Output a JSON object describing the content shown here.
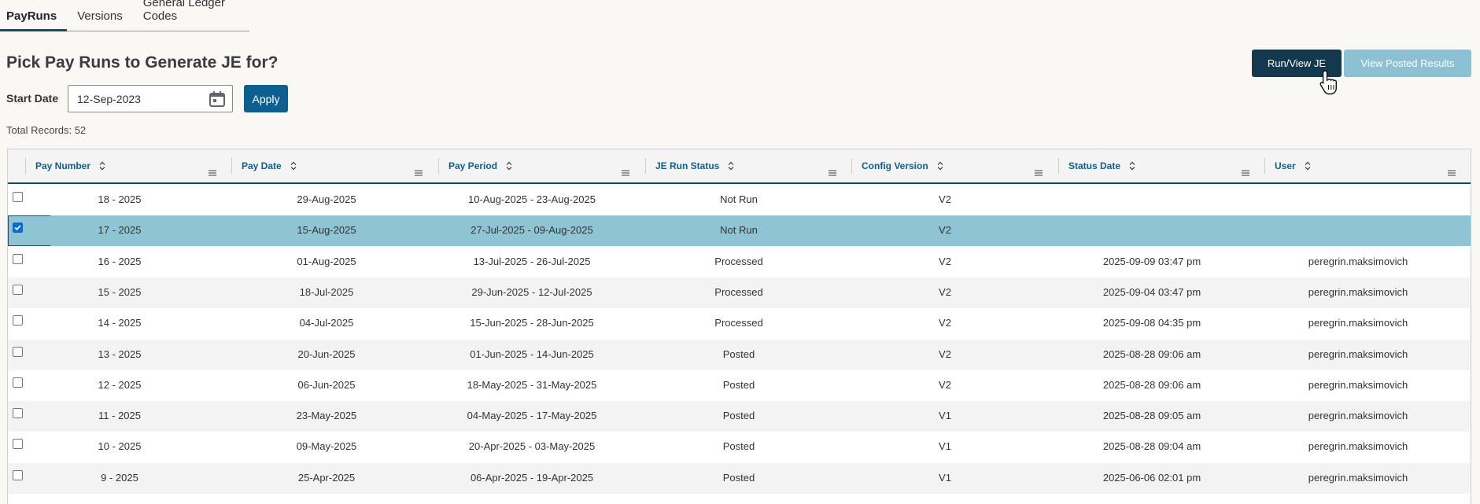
{
  "tabs": [
    "PayRuns",
    "Versions",
    "General Ledger Codes"
  ],
  "title": "Pick Pay Runs to Generate JE for?",
  "filter": {
    "start_label": "Start Date",
    "start_value": "12-Sep-2023",
    "apply_label": "Apply"
  },
  "total_records": "Total Records: 52",
  "actions": {
    "run_view": "Run/View JE",
    "view_posted": "View Posted Results"
  },
  "columns": [
    "Pay Number",
    "Pay Date",
    "Pay Period",
    "JE Run Status",
    "Config Version",
    "Status Date",
    "User"
  ],
  "rows": [
    {
      "pay_number": "18 - 2025",
      "pay_date": "29-Aug-2025",
      "pay_period": "10-Aug-2025 - 23-Aug-2025",
      "status": "Not Run",
      "config": "V2",
      "status_date": "",
      "user": "",
      "checked": false
    },
    {
      "pay_number": "17 - 2025",
      "pay_date": "15-Aug-2025",
      "pay_period": "27-Jul-2025 - 09-Aug-2025",
      "status": "Not Run",
      "config": "V2",
      "status_date": "",
      "user": "",
      "checked": true
    },
    {
      "pay_number": "16 - 2025",
      "pay_date": "01-Aug-2025",
      "pay_period": "13-Jul-2025 - 26-Jul-2025",
      "status": "Processed",
      "config": "V2",
      "status_date": "2025-09-09 03:47 pm",
      "user": "peregrin.maksimovich",
      "checked": false
    },
    {
      "pay_number": "15 - 2025",
      "pay_date": "18-Jul-2025",
      "pay_period": "29-Jun-2025 - 12-Jul-2025",
      "status": "Processed",
      "config": "V2",
      "status_date": "2025-09-04 03:47 pm",
      "user": "peregrin.maksimovich",
      "checked": false
    },
    {
      "pay_number": "14 - 2025",
      "pay_date": "04-Jul-2025",
      "pay_period": "15-Jun-2025 - 28-Jun-2025",
      "status": "Processed",
      "config": "V2",
      "status_date": "2025-09-08 04:35 pm",
      "user": "peregrin.maksimovich",
      "checked": false
    },
    {
      "pay_number": "13 - 2025",
      "pay_date": "20-Jun-2025",
      "pay_period": "01-Jun-2025 - 14-Jun-2025",
      "status": "Posted",
      "config": "V2",
      "status_date": "2025-08-28 09:06 am",
      "user": "peregrin.maksimovich",
      "checked": false
    },
    {
      "pay_number": "12 - 2025",
      "pay_date": "06-Jun-2025",
      "pay_period": "18-May-2025 - 31-May-2025",
      "status": "Posted",
      "config": "V2",
      "status_date": "2025-08-28 09:06 am",
      "user": "peregrin.maksimovich",
      "checked": false
    },
    {
      "pay_number": "11 - 2025",
      "pay_date": "23-May-2025",
      "pay_period": "04-May-2025 - 17-May-2025",
      "status": "Posted",
      "config": "V1",
      "status_date": "2025-08-28 09:05 am",
      "user": "peregrin.maksimovich",
      "checked": false
    },
    {
      "pay_number": "10 - 2025",
      "pay_date": "09-May-2025",
      "pay_period": "20-Apr-2025 - 03-May-2025",
      "status": "Posted",
      "config": "V1",
      "status_date": "2025-08-28 09:04 am",
      "user": "peregrin.maksimovich",
      "checked": false
    },
    {
      "pay_number": "9 - 2025",
      "pay_date": "25-Apr-2025",
      "pay_period": "06-Apr-2025 - 19-Apr-2025",
      "status": "Posted",
      "config": "V1",
      "status_date": "2025-06-06 02:01 pm",
      "user": "peregrin.maksimovich",
      "checked": false
    }
  ],
  "colors": {
    "primary": "#14384d",
    "accent": "#0d5f8f",
    "selected_row": "#8ec4d3",
    "disabled_button": "#8cc1d4"
  }
}
